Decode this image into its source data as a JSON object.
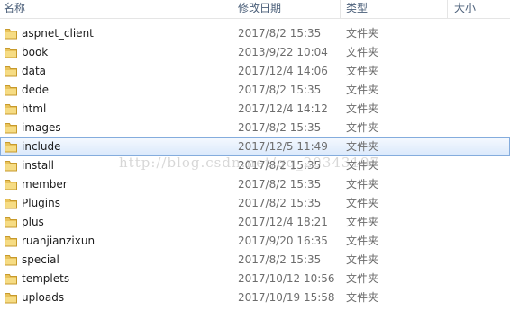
{
  "columns": {
    "name": "名称",
    "modified": "修改日期",
    "type": "类型",
    "size": "大小"
  },
  "files": [
    {
      "name": "aspnet_client",
      "modified": "2017/8/2 15:35",
      "type": "文件夹"
    },
    {
      "name": "book",
      "modified": "2013/9/22 10:04",
      "type": "文件夹"
    },
    {
      "name": "data",
      "modified": "2017/12/4 14:06",
      "type": "文件夹"
    },
    {
      "name": "dede",
      "modified": "2017/8/2 15:35",
      "type": "文件夹"
    },
    {
      "name": "html",
      "modified": "2017/12/4 14:12",
      "type": "文件夹"
    },
    {
      "name": "images",
      "modified": "2017/8/2 15:35",
      "type": "文件夹"
    },
    {
      "name": "include",
      "modified": "2017/12/5 11:49",
      "type": "文件夹",
      "selected": true
    },
    {
      "name": "install",
      "modified": "2017/8/2 15:35",
      "type": "文件夹"
    },
    {
      "name": "member",
      "modified": "2017/8/2 15:35",
      "type": "文件夹"
    },
    {
      "name": "Plugins",
      "modified": "2017/8/2 15:35",
      "type": "文件夹"
    },
    {
      "name": "plus",
      "modified": "2017/12/4 18:21",
      "type": "文件夹"
    },
    {
      "name": "ruanjianzixun",
      "modified": "2017/9/20 16:35",
      "type": "文件夹"
    },
    {
      "name": "special",
      "modified": "2017/8/2 15:35",
      "type": "文件夹"
    },
    {
      "name": "templets",
      "modified": "2017/10/12 10:56",
      "type": "文件夹"
    },
    {
      "name": "uploads",
      "modified": "2017/10/19 15:58",
      "type": "文件夹"
    }
  ],
  "watermark": "http://blog.csdn.net/qq_20343197",
  "icon": "folder-icon",
  "colors": {
    "selection": "#cde2fb",
    "selection_border": "#84acdd",
    "folder": "#e8c15a"
  }
}
